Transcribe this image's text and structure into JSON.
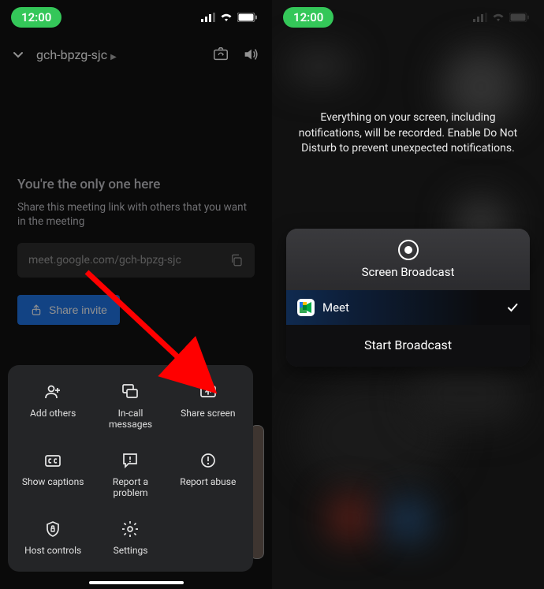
{
  "status": {
    "time": "12:00"
  },
  "left": {
    "meeting_code": "gch-bpzg-sjc",
    "only_one": "You're the only one here",
    "share_desc": "Share this meeting link with others that you want in the meeting",
    "meeting_url": "meet.google.com/gch-bpzg-sjc",
    "share_invite": "Share invite",
    "menu": {
      "add_others": "Add others",
      "in_call_messages": "In-call\nmessages",
      "share_screen": "Share screen",
      "show_captions": "Show captions",
      "report_problem": "Report a\nproblem",
      "report_abuse": "Report abuse",
      "host_controls": "Host controls",
      "settings": "Settings"
    }
  },
  "right": {
    "disclosure": "Everything on your screen, including notifications, will be recorded. Enable Do Not Disturb to prevent unexpected notifications.",
    "card": {
      "title": "Screen Broadcast",
      "app_name": "Meet",
      "start": "Start Broadcast"
    }
  }
}
